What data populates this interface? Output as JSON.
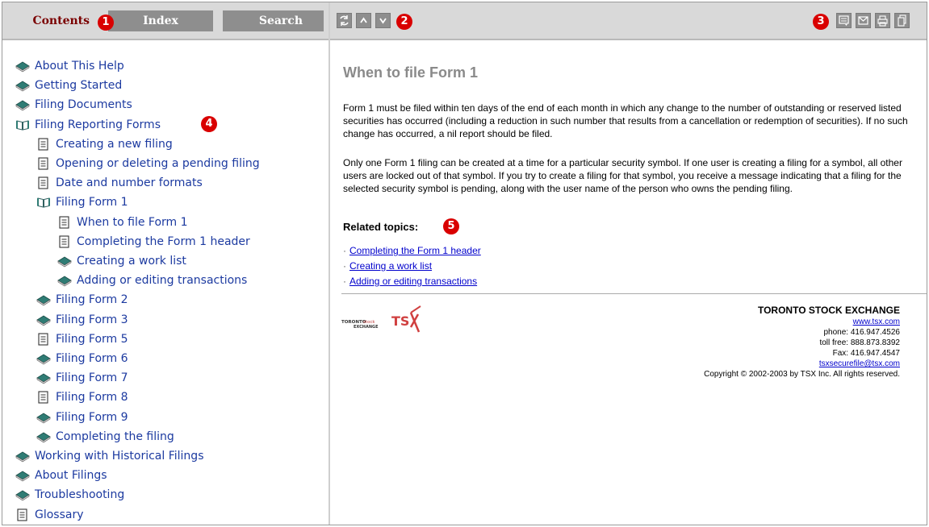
{
  "tabs": {
    "contents": "Contents",
    "index": "Index",
    "search": "Search"
  },
  "badges": {
    "b1": "1",
    "b2": "2",
    "b3": "3",
    "b4": "4",
    "b5": "5"
  },
  "toolbar": {
    "sync_icon": "sync-icon",
    "prev_icon": "up-arrow-icon",
    "next_icon": "down-arrow-icon",
    "right_icons": [
      "show-hide-icon",
      "email-icon",
      "print-icon",
      "copy-icon"
    ]
  },
  "nav": {
    "items": [
      {
        "label": "About This Help",
        "icon": "book"
      },
      {
        "label": "Getting Started",
        "icon": "book"
      },
      {
        "label": "Filing Documents",
        "icon": "book"
      },
      {
        "label": "Filing Reporting Forms",
        "icon": "open-book"
      },
      {
        "label": "Creating a new filing",
        "icon": "page"
      },
      {
        "label": "Opening or deleting a pending filing",
        "icon": "page"
      },
      {
        "label": "Date and number formats",
        "icon": "page"
      },
      {
        "label": "Filing Form 1",
        "icon": "open-book"
      },
      {
        "label": "When to file Form 1",
        "icon": "page"
      },
      {
        "label": "Completing the Form 1 header",
        "icon": "page"
      },
      {
        "label": "Creating a work list",
        "icon": "book"
      },
      {
        "label": "Adding or editing transactions",
        "icon": "book"
      },
      {
        "label": "Filing Form 2",
        "icon": "book"
      },
      {
        "label": "Filing Form 3",
        "icon": "book"
      },
      {
        "label": "Filing Form 5",
        "icon": "page"
      },
      {
        "label": "Filing Form 6",
        "icon": "book"
      },
      {
        "label": "Filing Form 7",
        "icon": "book"
      },
      {
        "label": "Filing Form 8",
        "icon": "page"
      },
      {
        "label": "Filing Form 9",
        "icon": "book"
      },
      {
        "label": "Completing the filing",
        "icon": "book"
      },
      {
        "label": "Working with Historical Filings",
        "icon": "book"
      },
      {
        "label": "About Filings",
        "icon": "book"
      },
      {
        "label": "Troubleshooting",
        "icon": "book"
      },
      {
        "label": "Glossary",
        "icon": "page"
      }
    ]
  },
  "content": {
    "title": "When to file Form 1",
    "para1": "Form 1 must be filed within ten days of the end of each month in which any change to the number of outstanding or reserved listed securities has occurred (including a reduction in such number that results from a cancellation or redemption of securities). If no such change has occurred, a nil report should be filed.",
    "para2": "Only one Form 1 filing can be created at a time for a particular security symbol. If one user is creating a filing for a symbol, all other users are locked out of that symbol. If you try to create a filing for that symbol, you receive a message indicating that a filing for the selected security symbol is pending, along with the user name of the person who owns the pending filing.",
    "related_title": "Related topics:",
    "related": [
      "Completing the Form 1 header",
      "Creating a work list",
      "Adding or editing transactions"
    ]
  },
  "footer": {
    "org": "TORONTO STOCK EXCHANGE",
    "website": "www.tsx.com",
    "phone": "phone: 416.947.4526",
    "tollfree": "toll free: 888.873.8392",
    "fax": "Fax: 416.947.4547",
    "email": "tsxsecurefile@tsx.com",
    "copyright": "Copyright © 2002-2003 by TSX Inc. All rights reserved."
  },
  "logo": {
    "line1a": "TORONTO",
    "line1b": "stock",
    "line2": "EXCHANGE",
    "mark": "TSX"
  },
  "colors": {
    "link": "#1c3aa0",
    "badge": "#d90000",
    "tab_active_text": "#7a0000",
    "tab_inactive_bg": "#8e8e8e"
  }
}
